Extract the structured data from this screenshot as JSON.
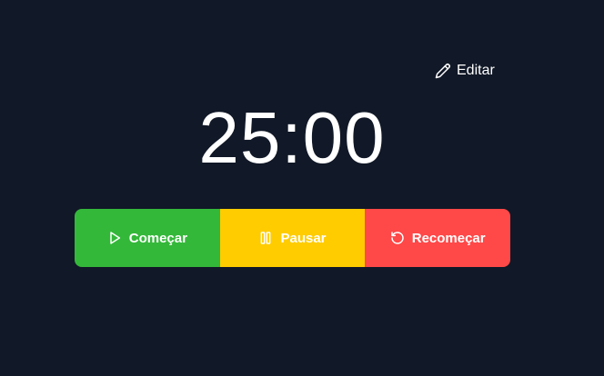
{
  "header": {
    "edit_label": "Editar",
    "edit_icon": "pencil-icon"
  },
  "timer": {
    "display": "25:00"
  },
  "controls": {
    "start": {
      "label": "Começar",
      "icon": "play-icon",
      "color": "#34b83a"
    },
    "pause": {
      "label": "Pausar",
      "icon": "pause-icon",
      "color": "#ffcc00"
    },
    "reset": {
      "label": "Recomeçar",
      "icon": "restart-icon",
      "color": "#ff4848"
    }
  },
  "theme": {
    "background": "#111827",
    "text": "#ffffff"
  }
}
